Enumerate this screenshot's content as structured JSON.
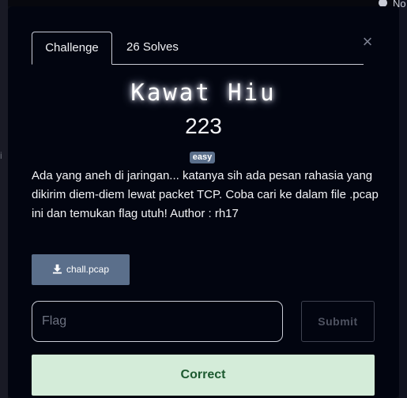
{
  "top_nav": {
    "user_text": "No"
  },
  "tabs": [
    {
      "label": "Challenge"
    },
    {
      "label": "26 Solves"
    }
  ],
  "challenge": {
    "title": "Kawat Hiu",
    "value": "223",
    "difficulty": "easy",
    "description": "Ada yang aneh di jaringan... katanya sih ada pesan rahasia yang dikirim diem-diem lewat packet TCP. Coba cari ke dalam file .pcap ini dan temukan flag utuh! Author : rh17",
    "file_label": "chall.pcap"
  },
  "flag": {
    "placeholder": "Flag",
    "value": ""
  },
  "submit_label": "Submit",
  "result_message": "Correct",
  "colors": {
    "modal_bg": "#020510",
    "badge_bg": "#5b6f8b",
    "file_button_bg": "#5b6f8b",
    "success_bg": "#d4ecd9",
    "success_text": "#1d5a30"
  },
  "icons": {
    "close": "close-icon",
    "download": "download-icon",
    "user": "user-icon"
  }
}
